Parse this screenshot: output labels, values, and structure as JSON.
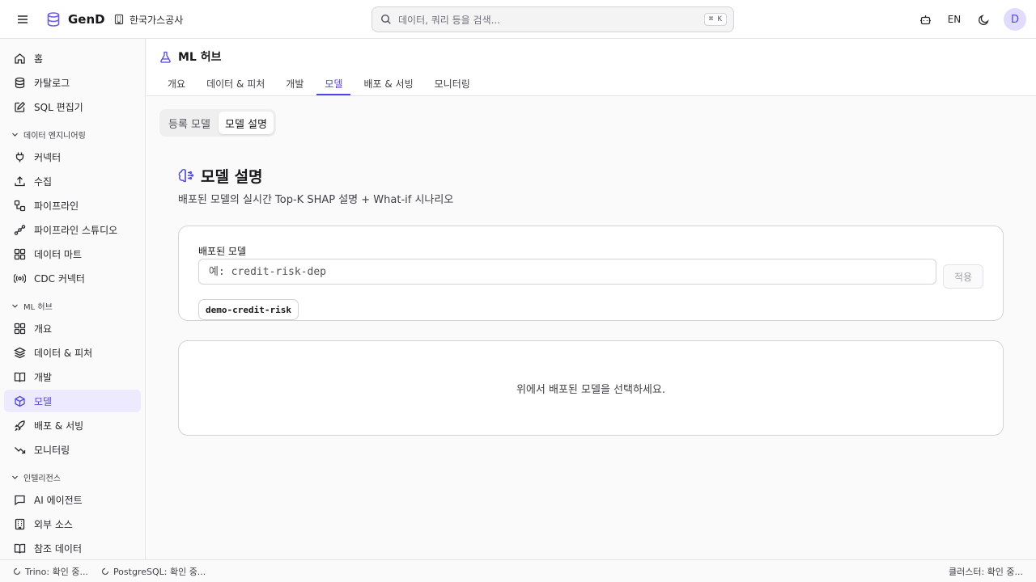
{
  "app": {
    "name": "GenD",
    "org": "한국가스공사"
  },
  "search": {
    "placeholder": "데이터, 쿼리 등을 검색...",
    "shortcut": "⌘ K"
  },
  "topbar": {
    "lang": "EN",
    "avatar_initial": "D"
  },
  "sidebar": {
    "top_items": [
      {
        "label": "홈",
        "icon": "home-icon"
      },
      {
        "label": "카탈로그",
        "icon": "database-icon"
      },
      {
        "label": "SQL 편집기",
        "icon": "edit-icon"
      }
    ],
    "sections": [
      {
        "title": "데이터 엔지니어링",
        "items": [
          {
            "label": "커넥터",
            "icon": "plug-icon"
          },
          {
            "label": "수집",
            "icon": "upload-icon"
          },
          {
            "label": "파이프라인",
            "icon": "workflow-icon"
          },
          {
            "label": "파이프라인 스튜디오",
            "icon": "nodes-icon"
          },
          {
            "label": "데이터 마트",
            "icon": "grid-icon"
          },
          {
            "label": "CDC 커넥터",
            "icon": "radio-icon"
          }
        ]
      },
      {
        "title": "ML 허브",
        "items": [
          {
            "label": "개요",
            "icon": "grid-icon"
          },
          {
            "label": "데이터 & 피처",
            "icon": "layers-icon"
          },
          {
            "label": "개발",
            "icon": "book-icon"
          },
          {
            "label": "모델",
            "icon": "cube-icon",
            "active": true
          },
          {
            "label": "배포 & 서빙",
            "icon": "rocket-icon"
          },
          {
            "label": "모니터링",
            "icon": "trend-down-icon"
          }
        ]
      },
      {
        "title": "인텔리전스",
        "items": [
          {
            "label": "AI 에이전트",
            "icon": "message-icon"
          },
          {
            "label": "외부 소스",
            "icon": "building-icon"
          },
          {
            "label": "참조 데이터",
            "icon": "book-icon"
          }
        ]
      }
    ]
  },
  "page": {
    "title": "ML 허브",
    "tabs": [
      {
        "label": "개요"
      },
      {
        "label": "데이터 & 피처"
      },
      {
        "label": "개발"
      },
      {
        "label": "모델",
        "active": true
      },
      {
        "label": "배포 & 서빙"
      },
      {
        "label": "모니터링"
      }
    ],
    "segments": [
      {
        "label": "등록 모델"
      },
      {
        "label": "모델 설명",
        "active": true
      }
    ],
    "section_title": "모델 설명",
    "section_subtitle": "배포된 모델의 실시간 Top-K SHAP 설명 + What-if 시나리오"
  },
  "model_select": {
    "label": "배포된 모델",
    "placeholder": "예: credit-risk-dep",
    "value": "",
    "apply_label": "적용",
    "chips": [
      "demo-credit-risk"
    ]
  },
  "empty_state": {
    "message": "위에서 배포된 모델을 선택하세요."
  },
  "status": {
    "trino": "Trino: 확인 중...",
    "postgres": "PostgreSQL: 확인 중...",
    "cluster": "클러스터: 확인 중..."
  },
  "colors": {
    "accent": "#4f46e5",
    "accent_bg": "#ede9fe"
  }
}
